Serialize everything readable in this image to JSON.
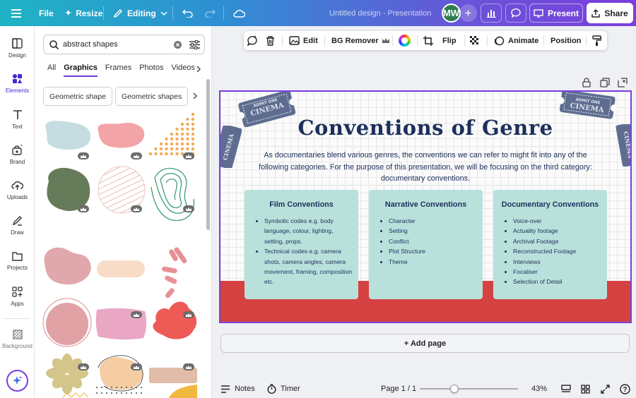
{
  "topbar": {
    "file": "File",
    "resize": "Resize",
    "editing": "Editing",
    "doc_title": "Untitled design - Presentation",
    "avatar": "MW",
    "plus": "+",
    "present": "Present",
    "share": "Share"
  },
  "rail": [
    {
      "label": "Design",
      "icon": "design-icon"
    },
    {
      "label": "Elements",
      "icon": "elements-icon"
    },
    {
      "label": "Text",
      "icon": "text-icon"
    },
    {
      "label": "Brand",
      "icon": "brand-icon"
    },
    {
      "label": "Uploads",
      "icon": "uploads-icon"
    },
    {
      "label": "Draw",
      "icon": "draw-icon"
    },
    {
      "label": "Projects",
      "icon": "projects-icon"
    },
    {
      "label": "Apps",
      "icon": "apps-icon"
    },
    {
      "label": "Background",
      "icon": "background-icon"
    }
  ],
  "panel": {
    "search_value": "abstract shapes",
    "tabs": [
      "All",
      "Graphics",
      "Frames",
      "Photos",
      "Videos"
    ],
    "active_tab": "Graphics",
    "chips": [
      "Geometric shape",
      "Geometric shapes"
    ]
  },
  "context_toolbar": {
    "edit": "Edit",
    "bg_remover": "BG Remover",
    "flip": "Flip",
    "animate": "Animate",
    "position": "Position"
  },
  "slide": {
    "title": "Conventions of Genre",
    "body": "As documentaries blend various genres, the conventions we can refer to might fit into any of the following categories. For the purpose of this presentation, we will be focusing on the third category: documentary conventions.",
    "ticket_text": [
      "ADMIT ONE",
      "CINEMA"
    ],
    "cards": [
      {
        "title": "Film Conventions",
        "items": [
          "Symbolic codes e.g. body language, colour, lighting, setting, props.",
          "Technical codes e.g. camera shots, camera angles, camera movement, framing, composition etc."
        ]
      },
      {
        "title": "Narrative Conventions",
        "items": [
          "Character",
          "Setting",
          "Conflict",
          "Plot Structure",
          "Theme"
        ]
      },
      {
        "title": "Documentary Conventions",
        "items": [
          "Voice-over",
          "Actuality footage",
          "Archival Footage",
          "Reconstructed Footage",
          "Interviews",
          "Focaliser",
          "Selection of Detail"
        ]
      }
    ]
  },
  "add_page": "+ Add page",
  "bottom": {
    "notes": "Notes",
    "timer": "Timer",
    "page": "Page 1 / 1",
    "zoom": "43%",
    "zoom_fraction": 0.35
  },
  "colors": {
    "accent": "#7d3fe0",
    "slide_navy": "#1c2f5c",
    "card_teal": "#b9e1db",
    "band_red": "#d54241"
  }
}
